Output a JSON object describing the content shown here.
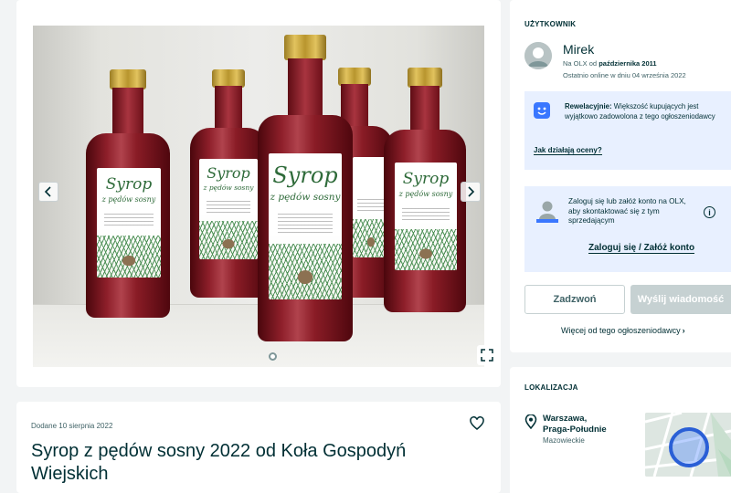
{
  "gallery": {
    "label_title_1": "Syrop",
    "label_title_2": "z pędów sosny",
    "slide_count": 1,
    "active_slide": 1
  },
  "ad": {
    "date_added": "Dodane 10 sierpnia 2022",
    "title": "Syrop z pędów sosny 2022 od Koła Gospodyń Wiejskich"
  },
  "seller": {
    "section_title": "UŻYTKOWNIK",
    "name": "Mirek",
    "since_prefix": "Na OLX od ",
    "since_date": "października 2011",
    "last_online": "Ostatnio online w dniu 04 września 2022"
  },
  "rating": {
    "headline": "Rewelacyjnie:",
    "text": " Większość kupujących jest wyjątkowo zadowolona z tego ogłoszeniodawcy",
    "link": "Jak działają oceny?"
  },
  "login": {
    "text": "Zaloguj się lub załóż konto na OLX, aby skontaktować się z tym sprzedającym",
    "link": "Zaloguj się / Załóż konto",
    "info_glyph": "i"
  },
  "actions": {
    "call_label": "Zadzwoń",
    "message_label": "Wyślij wiadomość",
    "more_label": "Więcej od tego ogłoszeniodawcy",
    "more_chevron": "›"
  },
  "location": {
    "section_title": "LOKALIZACJA",
    "city_line1": "Warszawa,",
    "city_line2": "Praga-Południe",
    "region": "Mazowieckie"
  },
  "colors": {
    "brand_dark": "#002f34",
    "muted_text": "#406367",
    "info_box": "#e8f0ff",
    "rating_icon": "#3a77ff",
    "button_disabled": "#c6d1d2",
    "page_bg": "#f2f4f5"
  },
  "icons": {
    "prev": "chevron-left-icon",
    "next": "chevron-right-icon",
    "fullscreen": "expand-icon",
    "favorite": "heart-icon",
    "info": "info-icon",
    "location": "map-pin-icon"
  }
}
